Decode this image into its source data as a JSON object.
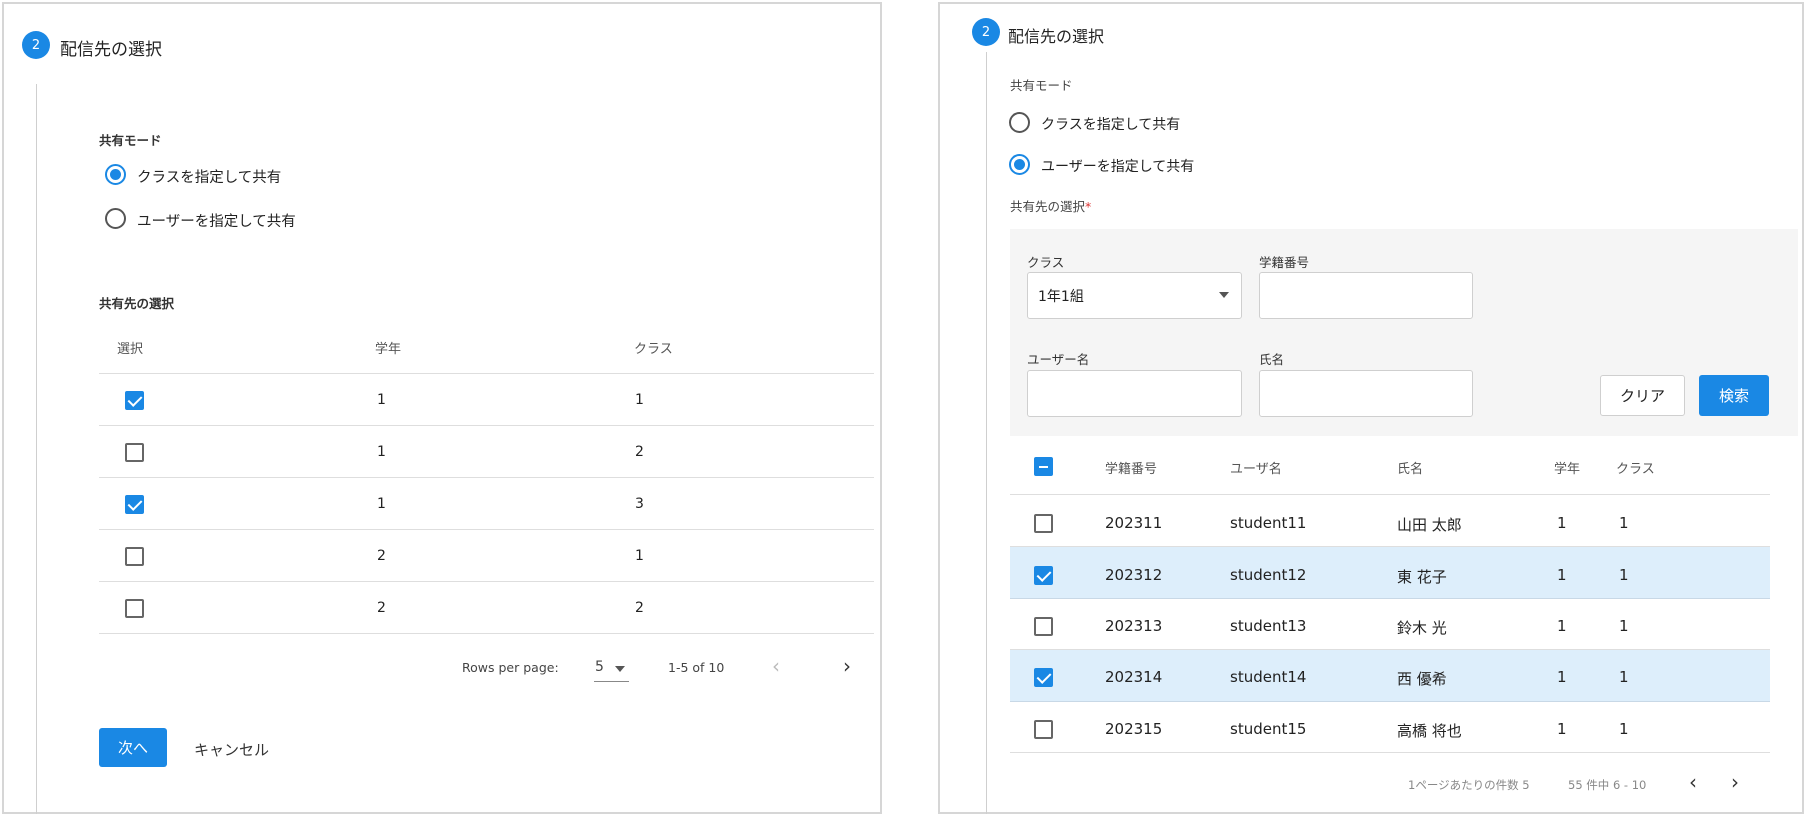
{
  "left": {
    "step_number": "2",
    "step_title": "配信先の選択",
    "share_mode_label": "共有モード",
    "radio_options": [
      {
        "label": "クラスを指定して共有",
        "selected": true
      },
      {
        "label": "ユーザーを指定して共有",
        "selected": false
      }
    ],
    "target_label": "共有先の選択",
    "table": {
      "headers": [
        "選択",
        "学年",
        "クラス"
      ],
      "rows": [
        {
          "checked": true,
          "grade": "1",
          "class": "1"
        },
        {
          "checked": false,
          "grade": "1",
          "class": "2"
        },
        {
          "checked": true,
          "grade": "1",
          "class": "3"
        },
        {
          "checked": false,
          "grade": "2",
          "class": "1"
        },
        {
          "checked": false,
          "grade": "2",
          "class": "2"
        }
      ]
    },
    "pager": {
      "rows_per_page_label": "Rows per page:",
      "rows_per_page_value": "5",
      "range": "1-5 of 10",
      "prev_icon": "chevron-left-icon",
      "next_icon": "chevron-right-icon"
    },
    "next_button": "次へ",
    "cancel_button": "キャンセル"
  },
  "right": {
    "step_number": "2",
    "step_title": "配信先の選択",
    "share_mode_label": "共有モード",
    "radio_options": [
      {
        "label": "クラスを指定して共有",
        "selected": false
      },
      {
        "label": "ユーザーを指定して共有",
        "selected": true
      }
    ],
    "target_label": "共有先の選択",
    "required_mark": "*",
    "filters": {
      "class_label": "クラス",
      "class_value": "1年1組",
      "student_no_label": "学籍番号",
      "student_no_value": "",
      "username_label": "ユーザー名",
      "username_value": "",
      "name_label": "氏名",
      "name_value": "",
      "clear_button": "クリア",
      "search_button": "検索"
    },
    "table": {
      "headers": [
        "学籍番号",
        "ユーザ名",
        "氏名",
        "学年",
        "クラス"
      ],
      "header_checkbox": "partial",
      "rows": [
        {
          "checked": false,
          "student_no": "202311",
          "username": "student11",
          "name": "山田 太郎",
          "grade": "1",
          "class": "1"
        },
        {
          "checked": true,
          "student_no": "202312",
          "username": "student12",
          "name": "東 花子",
          "grade": "1",
          "class": "1"
        },
        {
          "checked": false,
          "student_no": "202313",
          "username": "student13",
          "name": "鈴木 光",
          "grade": "1",
          "class": "1"
        },
        {
          "checked": true,
          "student_no": "202314",
          "username": "student14",
          "name": "西 優希",
          "grade": "1",
          "class": "1"
        },
        {
          "checked": false,
          "student_no": "202315",
          "username": "student15",
          "name": "高橋 将也",
          "grade": "1",
          "class": "1"
        }
      ]
    },
    "pager": {
      "rows_per_page_label": "1ページあたりの件数 5",
      "range": "55 件中 6 - 10",
      "prev_icon": "chevron-left-icon",
      "next_icon": "chevron-right-icon"
    }
  },
  "colors": {
    "accent": "#1a88e4",
    "row_highlight": "#ddeefb",
    "border": "#d6d6d6",
    "filter_bg": "#f5f5f5"
  }
}
